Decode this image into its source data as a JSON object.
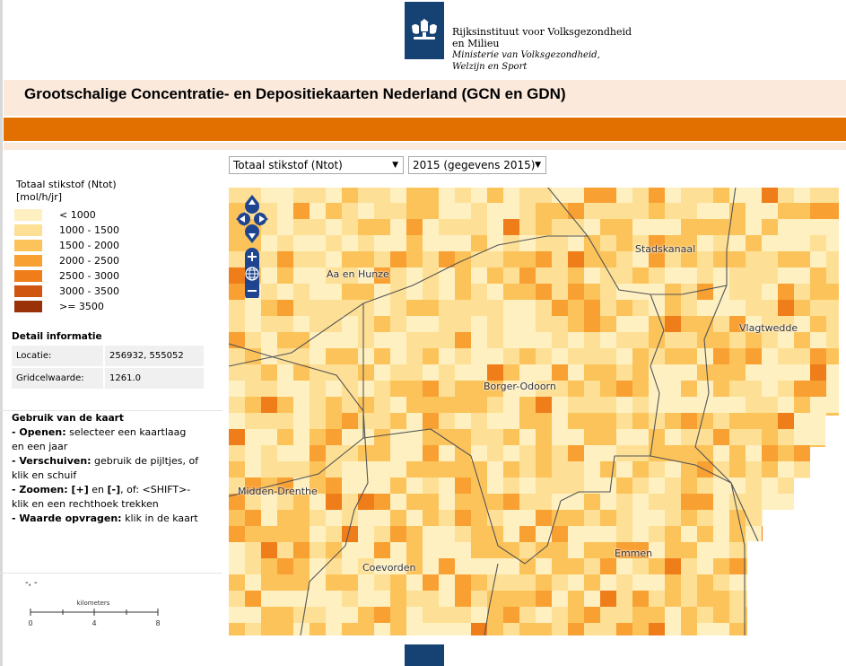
{
  "header": {
    "org_line1": "Rijksinstituut voor Volksgezondheid",
    "org_line2": "en Milieu",
    "org_line3": "Ministerie van Volksgezondheid,",
    "org_line4": "Welzijn en Sport",
    "title": "Grootschalige Concentratie- en Depositiekaarten Nederland (GCN en GDN)"
  },
  "controls": {
    "component_select": "Totaal stikstof (Ntot)",
    "year_select": "2015 (gegevens 2015)"
  },
  "legend": {
    "title": "Totaal stikstof (Ntot)",
    "unit": "[mol/h/jr]",
    "classes": [
      {
        "label": "< 1000",
        "color": "#fef0c1"
      },
      {
        "label": "1000 - 1500",
        "color": "#fde095"
      },
      {
        "label": "1500 - 2000",
        "color": "#fcc35a"
      },
      {
        "label": "2000 - 2500",
        "color": "#f9a033"
      },
      {
        "label": "2500 - 3000",
        "color": "#ee7d1a"
      },
      {
        "label": "3000 - 3500",
        "color": "#cf5510"
      },
      {
        "label": ">= 3500",
        "color": "#993208"
      }
    ]
  },
  "detail": {
    "heading": "Detail informatie",
    "rows": [
      {
        "key": "Locatie:",
        "value": "256932, 555052"
      },
      {
        "key": "Gridcelwaarde:",
        "value": "1261.0"
      }
    ]
  },
  "usage": {
    "heading": "Gebruik van de kaart",
    "open_key": "- Openen:",
    "open_text": " selecteer een kaartlaag",
    "open_text2": "en een jaar",
    "move_key": "- Verschuiven:",
    "move_text": " gebruik de pijltjes, of",
    "move_text2": "klik en schuif",
    "zoom_key": "- Zoomen:",
    "zoom_plus": " [+]",
    "zoom_en": " en ",
    "zoom_minus": "[-]",
    "zoom_text": ", of: <SHIFT>-",
    "zoom_text2": "klik en een rechthoek trekken",
    "value_key": "- Waarde opvragen:",
    "value_text": " klik in de kaart"
  },
  "map": {
    "cursor_coords": "-, -",
    "scale_unit": "kilometers",
    "scale_ticks": [
      "0",
      "4",
      "8"
    ],
    "places": [
      {
        "name": "Aa en Hunze"
      },
      {
        "name": "Stadskanaal"
      },
      {
        "name": "Vlagtwedde"
      },
      {
        "name": "Borger-Odoorn"
      },
      {
        "name": "Midden-Drenthe"
      },
      {
        "name": "Coevorden"
      },
      {
        "name": "Emmen"
      }
    ]
  }
}
